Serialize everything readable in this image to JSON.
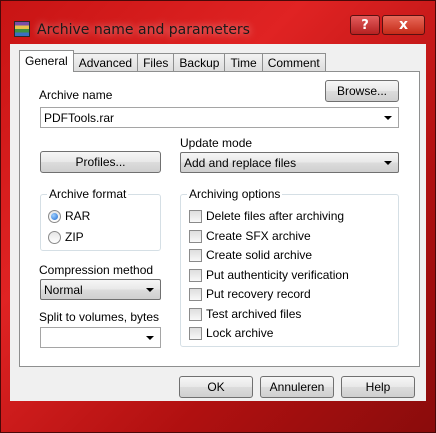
{
  "window": {
    "title": "Archive name and parameters",
    "help_label": "?",
    "close_label": "x",
    "accent": "#c81414"
  },
  "tabs": [
    {
      "label": "General",
      "active": true
    },
    {
      "label": "Advanced",
      "active": false
    },
    {
      "label": "Files",
      "active": false
    },
    {
      "label": "Backup",
      "active": false
    },
    {
      "label": "Time",
      "active": false
    },
    {
      "label": "Comment",
      "active": false
    }
  ],
  "general": {
    "archive_name_label": "Archive name",
    "browse_label": "Browse...",
    "archive_name_value": "PDFTools.rar",
    "update_mode_label": "Update mode",
    "update_mode_value": "Add and replace files",
    "profiles_label": "Profiles...",
    "archive_format": {
      "title": "Archive format",
      "options": [
        {
          "label": "RAR",
          "selected": true
        },
        {
          "label": "ZIP",
          "selected": false
        }
      ]
    },
    "compression_method_label": "Compression method",
    "compression_method_value": "Normal",
    "split_label": "Split to volumes, bytes",
    "split_value": "",
    "archiving_options": {
      "title": "Archiving options",
      "items": [
        {
          "label": "Delete files after archiving",
          "checked": false
        },
        {
          "label": "Create SFX archive",
          "checked": false
        },
        {
          "label": "Create solid archive",
          "checked": false
        },
        {
          "label": "Put authenticity verification",
          "checked": false
        },
        {
          "label": "Put recovery record",
          "checked": false
        },
        {
          "label": "Test archived files",
          "checked": false
        },
        {
          "label": "Lock archive",
          "checked": false
        }
      ]
    }
  },
  "buttons": {
    "ok": "OK",
    "cancel": "Annuleren",
    "help": "Help"
  }
}
